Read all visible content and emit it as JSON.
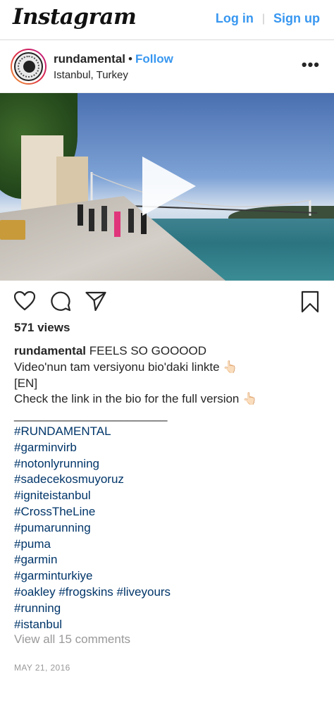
{
  "topbar": {
    "logo": "Instagram",
    "login_label": "Log in",
    "separator": "|",
    "signup_label": "Sign up"
  },
  "post": {
    "username": "rundamental",
    "dot": "•",
    "follow_label": "Follow",
    "location": "Istanbul, Turkey",
    "more_label": "•••",
    "views": "571 views",
    "caption": {
      "username": "rundamental",
      "first_line": "FEELS SO GOOOOD",
      "lines": [
        "Video'nun tam versiyonu bio'daki linkte 👆🏻",
        "[EN]",
        "Check the link in the bio for the full version 👆🏻",
        "_______________________"
      ],
      "hashtag_lines": [
        "#RUNDAMENTAL",
        "#garminvirb",
        "#notonlyrunning",
        "#sadecekosmuyoruz",
        "#igniteistanbul",
        "#CrossTheLine",
        "#pumarunning",
        "#puma",
        "#garmin",
        "#garminturkiye",
        "#oakley #frogskins #liveyours",
        "#running",
        "#istanbul"
      ]
    },
    "view_comments": "View all 15 comments",
    "date": "MAY 21, 2016"
  },
  "icons": {
    "like": "heart-icon",
    "comment": "comment-icon",
    "share": "share-icon",
    "save": "bookmark-icon",
    "play": "play-icon",
    "more": "more-options-icon"
  },
  "colors": {
    "link_blue": "#3897f0",
    "hashtag": "#003569",
    "muted": "#999999",
    "text": "#262626"
  }
}
